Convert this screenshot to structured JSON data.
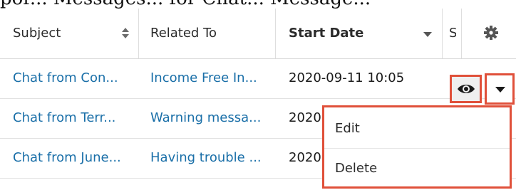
{
  "cropped_text": "por... Messages... for Chat... Message...",
  "table": {
    "headers": {
      "subject": "Subject",
      "related_to": "Related To",
      "start_date": "Start Date",
      "status_partial": "S"
    },
    "rows": [
      {
        "subject": "Chat from Con...",
        "related_to": "Income Free In...",
        "start_date": "2020-09-11 10:05"
      },
      {
        "subject": "Chat from Terr...",
        "related_to": "Warning messa...",
        "start_date": "2020"
      },
      {
        "subject": "Chat from June...",
        "related_to": "Having trouble ...",
        "start_date": "2020"
      }
    ]
  },
  "row_actions": {
    "preview_icon": "eye-icon",
    "dropdown_icon": "caret-down-icon"
  },
  "dropdown_menu": {
    "items": [
      {
        "label": "Edit"
      },
      {
        "label": "Delete"
      }
    ]
  },
  "colors": {
    "link": "#1a6fa8",
    "highlight_border": "#e0503a",
    "header_text": "#2b2b2b"
  }
}
